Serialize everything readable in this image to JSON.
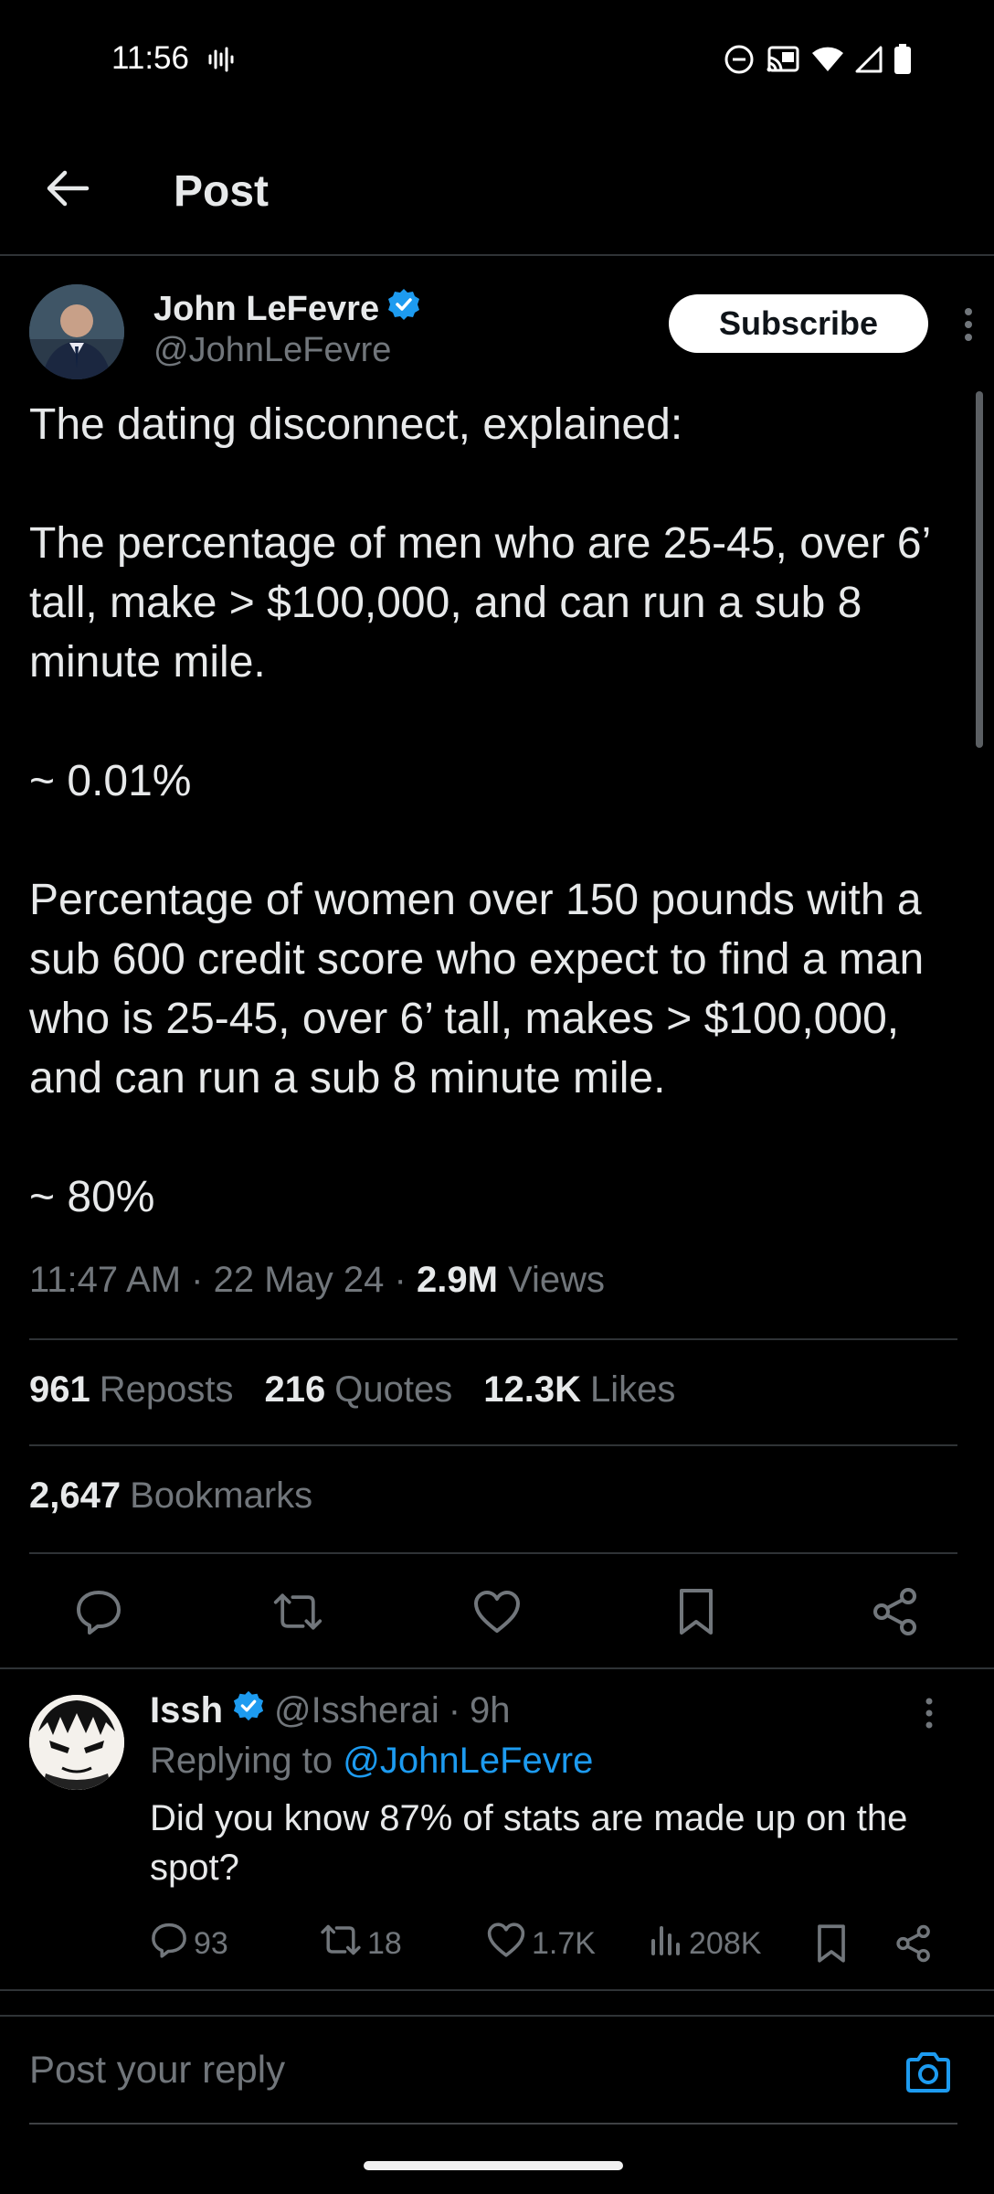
{
  "status_bar": {
    "time": "11:56",
    "left_icon": "voice-wave-icon",
    "right_icons": [
      "do-not-disturb-icon",
      "cast-icon",
      "wifi-icon",
      "cell-signal-icon",
      "battery-icon"
    ]
  },
  "header": {
    "back_icon": "back-arrow-icon",
    "title": "Post"
  },
  "tweet": {
    "author_name": "John LeFevre",
    "author_handle": "@JohnLeFevre",
    "verified_icon": "verified-badge-icon",
    "subscribe_label": "Subscribe",
    "text": "The dating disconnect, explained:\n\nThe percentage of men who are 25-45, over 6’ tall, make > $100,000, and can run a sub 8 minute mile.\n\n~ 0.01%\n\nPercentage of women over 150 pounds with a sub 600 credit score who expect to find a man who is 25-45, over 6’ tall, makes > $100,000, and can run a sub 8 minute mile.\n\n~ 80%",
    "time": "11:47 AM",
    "date": "22 May 24",
    "views_count": "2.9M",
    "views_label": "Views",
    "separator": "·"
  },
  "stats": {
    "reposts_count": "961",
    "reposts_label": "Reposts",
    "quotes_count": "216",
    "quotes_label": "Quotes",
    "likes_count": "12.3K",
    "likes_label": "Likes",
    "bookmarks_count": "2,647",
    "bookmarks_label": "Bookmarks"
  },
  "actions": [
    "reply-icon",
    "repost-icon",
    "like-icon",
    "bookmark-icon",
    "share-icon"
  ],
  "reply": {
    "name": "Issh",
    "handle": "@Issherai",
    "separator": "·",
    "age": "9h",
    "replying_prefix": "Replying to",
    "replying_to": "@JohnLeFevre",
    "text": "Did you know 87% of stats are made up on the spot?",
    "reply_count": "93",
    "repost_count": "18",
    "like_count": "1.7K",
    "view_count": "208K"
  },
  "compose": {
    "placeholder": "Post your reply",
    "camera_icon": "camera-icon"
  },
  "colors": {
    "background": "#000000",
    "text_primary": "#e7e9ea",
    "text_secondary": "#71767b",
    "accent": "#1d9bf0",
    "divider": "#2f3336"
  }
}
